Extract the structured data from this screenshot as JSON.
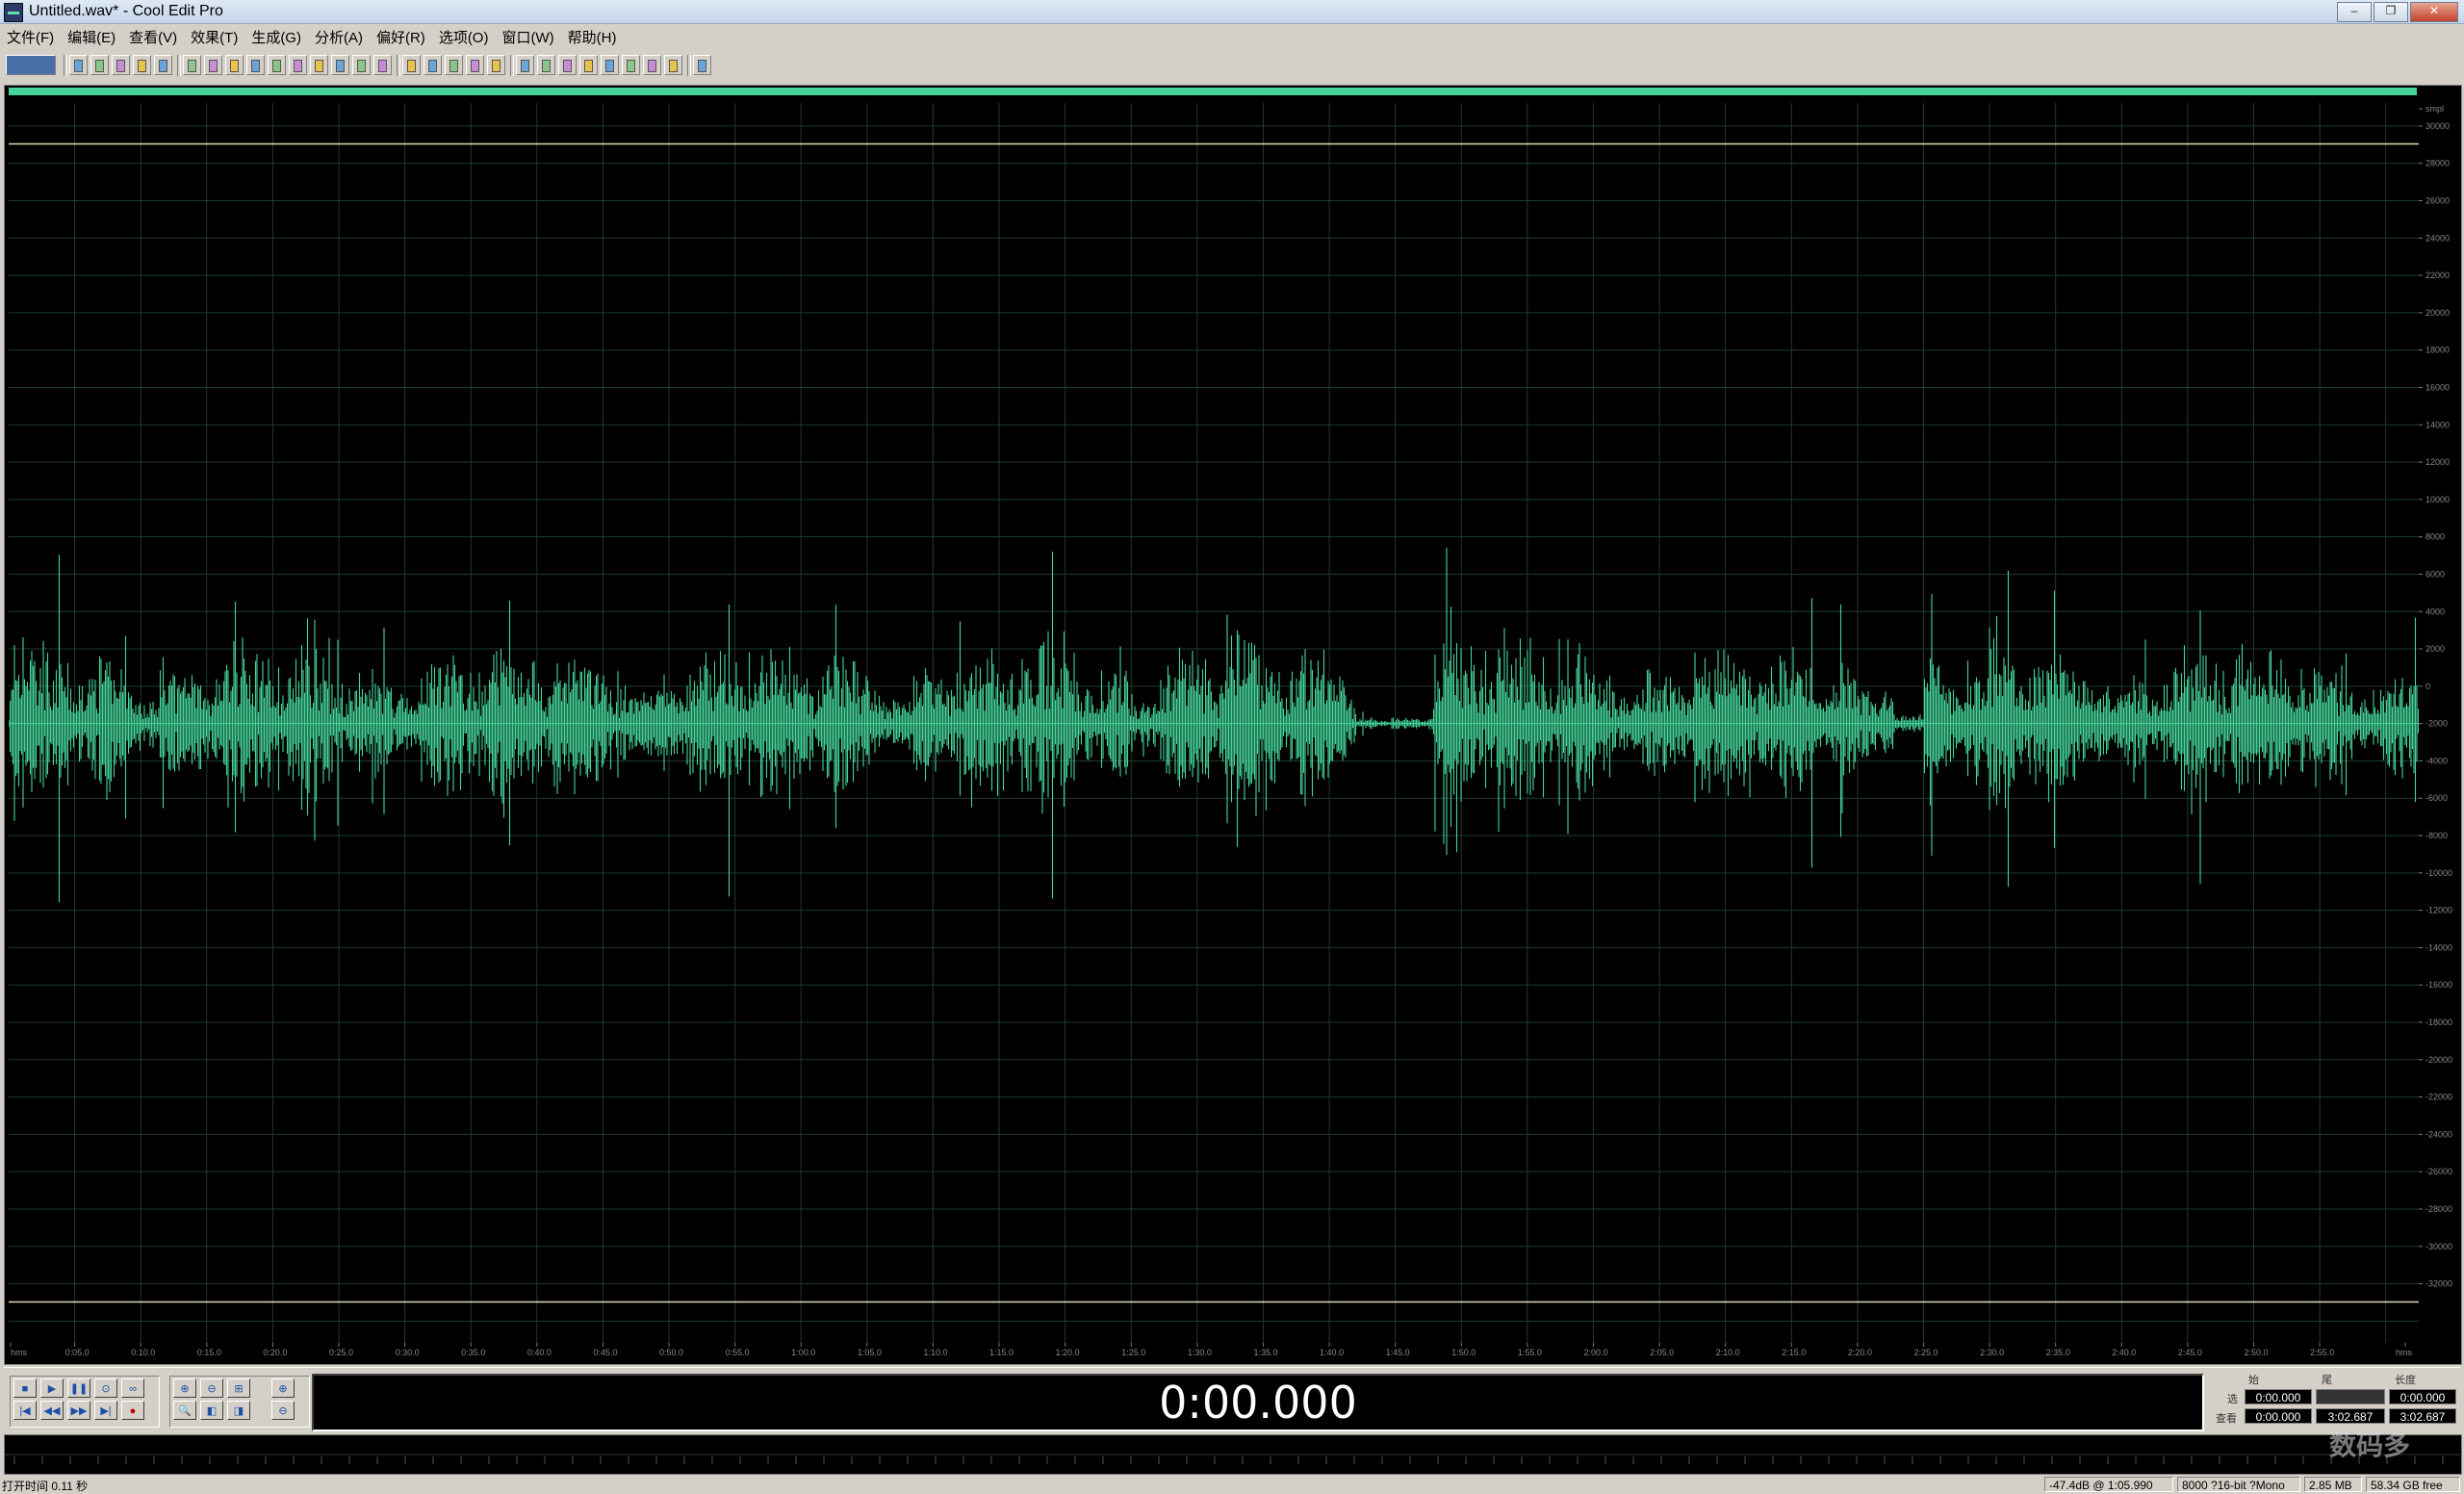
{
  "window": {
    "title": "Untitled.wav* - Cool Edit Pro",
    "min": "–",
    "max": "❐",
    "close": "✕"
  },
  "menu": [
    "文件(F)",
    "编辑(E)",
    "查看(V)",
    "效果(T)",
    "生成(G)",
    "分析(A)",
    "偏好(R)",
    "选项(O)",
    "窗口(W)",
    "帮助(H)"
  ],
  "toolbar_icons": [
    "mode-switch",
    "new",
    "open",
    "save",
    "save-all",
    "close",
    "undo",
    "redo",
    "repeat",
    "cut",
    "copy",
    "paste",
    "mix-paste",
    "trim",
    "delete",
    "select-all",
    "view-waveform",
    "view-spectral",
    "view-cue",
    "new-cue",
    "cue-list",
    "play-list",
    "snap",
    "zoom-fit",
    "scale",
    "grid",
    "region",
    "cursor",
    "settings",
    "help"
  ],
  "colors": {
    "waveform": "#45d39a",
    "background": "#000000",
    "grid": "#1e3b33"
  },
  "amplitude_labels": [
    "smpl",
    "30000",
    "28000",
    "26000",
    "24000",
    "22000",
    "20000",
    "18000",
    "16000",
    "14000",
    "12000",
    "10000",
    "8000",
    "6000",
    "4000",
    "2000",
    "0",
    "-2000",
    "-4000",
    "-6000",
    "-8000",
    "-10000",
    "-12000",
    "-14000",
    "-16000",
    "-18000",
    "-20000",
    "-22000",
    "-24000",
    "-26000",
    "-28000",
    "-30000",
    "-32000"
  ],
  "time_labels": [
    "hms",
    "0:05.0",
    "0:10.0",
    "0:15.0",
    "0:20.0",
    "0:25.0",
    "0:30.0",
    "0:35.0",
    "0:40.0",
    "0:45.0",
    "0:50.0",
    "0:55.0",
    "1:00.0",
    "1:05.0",
    "1:10.0",
    "1:15.0",
    "1:20.0",
    "1:25.0",
    "1:30.0",
    "1:35.0",
    "1:40.0",
    "1:45.0",
    "1:50.0",
    "1:55.0",
    "2:00.0",
    "2:05.0",
    "2:10.0",
    "2:15.0",
    "2:20.0",
    "2:25.0",
    "2:30.0",
    "2:35.0",
    "2:40.0",
    "2:45.0",
    "2:50.0",
    "2:55.0",
    "hms"
  ],
  "transport": {
    "time_display": "0:00.000",
    "buttons": {
      "stop": "■",
      "play": "▶",
      "pause": "❚❚",
      "play_to_end": "⊙",
      "loop": "∞",
      "go_start": "|◀",
      "rewind": "◀◀",
      "ffwd": "▶▶",
      "go_end": "▶|",
      "record": "●"
    },
    "zoom": {
      "in": "⊕",
      "out": "⊖",
      "full": "⊞",
      "vin": "⊕",
      "sel": "🔍",
      "left": "◧",
      "right": "◨",
      "vout": "⊖"
    }
  },
  "selection": {
    "col_start": "始",
    "col_end": "尾",
    "col_length": "长度",
    "row_sel": "选",
    "row_view": "查看",
    "sel_start": "0:00.000",
    "sel_end": "",
    "sel_length": "0:00.000",
    "view_start": "0:00.000",
    "view_end": "3:02.687",
    "view_length": "3:02.687"
  },
  "status": {
    "open_time": "打开时间 0.11 秒",
    "level": "-47.4dB @ 1:05.990",
    "format": "8000 ?16-bit ?Mono",
    "size": "2.85 MB",
    "free": "58.34 GB free"
  },
  "watermark": "数码多"
}
